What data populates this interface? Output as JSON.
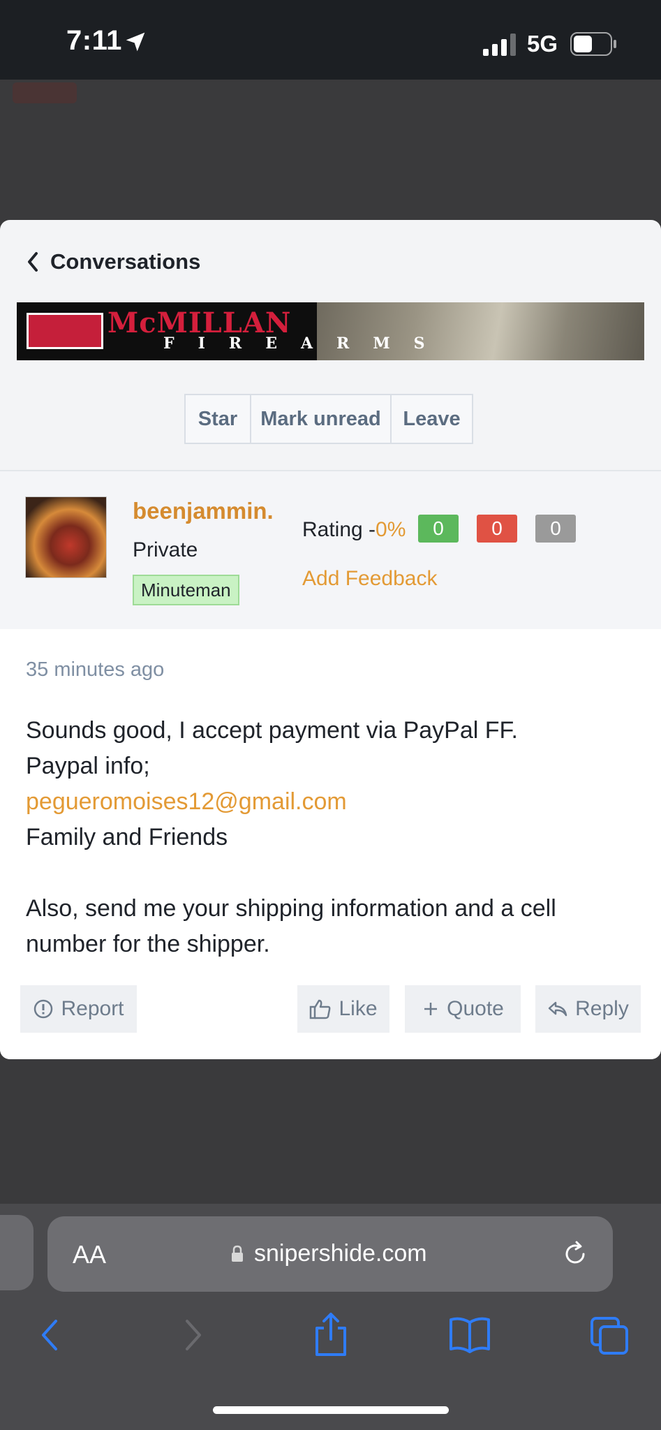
{
  "status_bar": {
    "time": "7:11",
    "network": "5G"
  },
  "header": {
    "back_label": "Conversations"
  },
  "banner": {
    "brand": "McMILLAN",
    "sub": "FIREARMS"
  },
  "actions": {
    "star": "Star",
    "mark_unread": "Mark unread",
    "leave": "Leave"
  },
  "user": {
    "name": "beenjammin.",
    "title": "Private",
    "badge": "Minuteman",
    "rating_label": "Rating -",
    "rating_pct": "0%",
    "positive": "0",
    "negative": "0",
    "neutral": "0",
    "add_feedback": "Add Feedback"
  },
  "message": {
    "time": "35 minutes ago",
    "line1": "Sounds good, I accept payment via PayPal FF.",
    "line2": "Paypal info;",
    "email": "pegueromoises12@gmail.com",
    "line3": "Family and Friends",
    "line4": "Also, send me your shipping information and a cell number for the shipper.",
    "report": "Report",
    "like": "Like",
    "quote": "Quote",
    "reply": "Reply"
  },
  "safari": {
    "aa": "AA",
    "url": "snipershide.com"
  },
  "colors": {
    "accent_orange": "#e39a35",
    "positive_green": "#5cb85c",
    "negative_red": "#e05244",
    "neutral_gray": "#9a9a9a",
    "link_blue": "#2f7cf6"
  }
}
